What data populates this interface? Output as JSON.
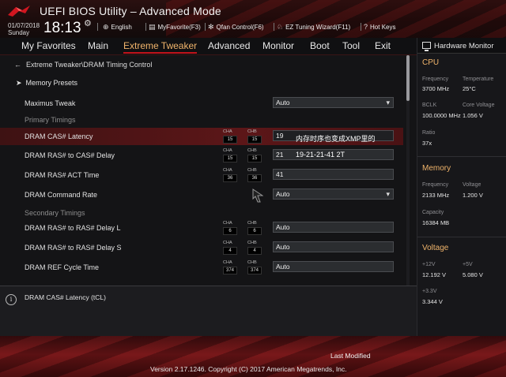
{
  "header": {
    "app_title": "UEFI BIOS Utility – Advanced Mode",
    "date": "01/07/2018",
    "day": "Sunday",
    "time": "18:13",
    "links": [
      {
        "label": "English",
        "icon": "globe-icon"
      },
      {
        "label": "MyFavorite(F3)",
        "icon": "favorite-icon"
      },
      {
        "label": "Qfan Control(F6)",
        "icon": "fan-icon"
      },
      {
        "label": "EZ Tuning Wizard(F11)",
        "icon": "wizard-icon"
      },
      {
        "label": "Hot Keys",
        "icon": "help-icon"
      }
    ]
  },
  "menu": {
    "tabs": [
      "My Favorites",
      "Main",
      "Extreme Tweaker",
      "Advanced",
      "Monitor",
      "Boot",
      "Tool",
      "Exit"
    ],
    "active": "Extreme Tweaker"
  },
  "breadcrumb": "Extreme Tweaker\\DRAM Timing Control",
  "presets_label": "Memory Presets",
  "rows": {
    "maximus_tweak": {
      "label": "Maximus Tweak",
      "value": "Auto"
    },
    "primary_header": "Primary Timings",
    "cas_latency": {
      "label": "DRAM CAS# Latency",
      "cha": "15",
      "chb": "15",
      "value": "19"
    },
    "ras_cas_delay": {
      "label": "DRAM RAS# to CAS# Delay",
      "cha": "15",
      "chb": "15",
      "value": "21"
    },
    "ras_act_time": {
      "label": "DRAM RAS# ACT Time",
      "cha": "36",
      "chb": "36",
      "value": "41"
    },
    "command_rate": {
      "label": "DRAM Command Rate",
      "value": "Auto"
    },
    "secondary_header": "Secondary Timings",
    "ras_ras_l": {
      "label": "DRAM RAS# to RAS# Delay L",
      "cha": "6",
      "chb": "6",
      "value": "Auto"
    },
    "ras_ras_s": {
      "label": "DRAM RAS# to RAS# Delay S",
      "cha": "4",
      "chb": "4",
      "value": "Auto"
    },
    "ref_cycle": {
      "label": "DRAM REF Cycle Time",
      "cha": "374",
      "chb": "374",
      "value": "Auto"
    }
  },
  "channel_labels": {
    "a": "CHA",
    "b": "CHB"
  },
  "annotation": {
    "line1": "内存时序也变成XMP里的",
    "line2": "19-21-21-41 2T"
  },
  "info_text": "DRAM CAS# Latency (tCL)",
  "hardware_monitor": {
    "title": "Hardware Monitor",
    "cpu": {
      "title": "CPU",
      "frequency_label": "Frequency",
      "frequency": "3700 MHz",
      "temperature_label": "Temperature",
      "temperature": "25°C",
      "bclk_label": "BCLK",
      "bclk": "100.0000 MHz",
      "core_voltage_label": "Core Voltage",
      "core_voltage": "1.056 V",
      "ratio_label": "Ratio",
      "ratio": "37x"
    },
    "memory": {
      "title": "Memory",
      "frequency_label": "Frequency",
      "frequency": "2133 MHz",
      "voltage_label": "Voltage",
      "voltage": "1.200 V",
      "capacity_label": "Capacity",
      "capacity": "16384 MB"
    },
    "voltage": {
      "title": "Voltage",
      "v12_label": "+12V",
      "v12": "12.192 V",
      "v5_label": "+5V",
      "v5": "5.080 V",
      "v33_label": "+3.3V",
      "v33": "3.344 V"
    }
  },
  "footer": {
    "last_modified": "Last Modified",
    "copyright": "Version 2.17.1246. Copyright (C) 2017 American Megatrends, Inc."
  },
  "colors": {
    "accent": "#f0b46b",
    "selected_row": "#5c1618",
    "brand_red": "#c0121a"
  }
}
